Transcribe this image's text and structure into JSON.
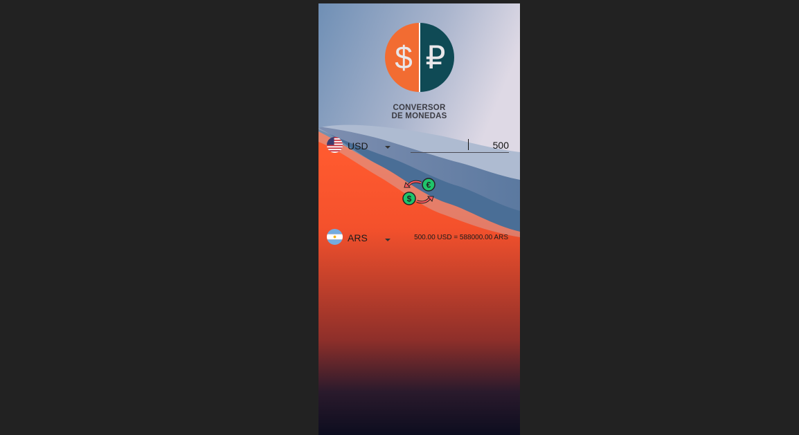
{
  "app": {
    "logo_line1": "CONVERSOR",
    "logo_line2": "DE MONEDAS",
    "logo_left_symbol": "$",
    "logo_right_symbol": "₽"
  },
  "from": {
    "currency": "USD",
    "flag": "us-flag-icon",
    "amount": "500"
  },
  "to": {
    "currency": "ARS",
    "flag": "argentina-flag-icon"
  },
  "swap_icon": "currency-exchange-icon",
  "swap_symbols": {
    "top": "€",
    "bottom": "$"
  },
  "result_text": "500.00 USD = 588000.00 ARS",
  "colors": {
    "accent_orange": "#f26c32",
    "accent_teal": "#0f4a55",
    "swap_green": "#1fc46b"
  }
}
